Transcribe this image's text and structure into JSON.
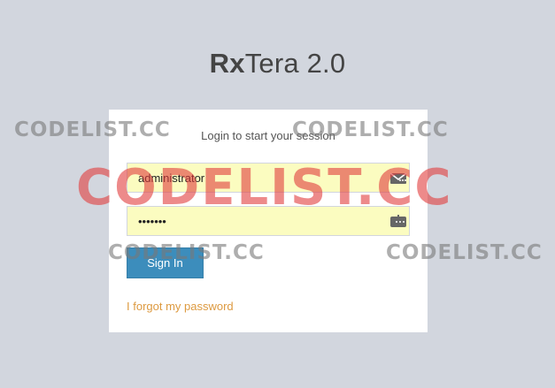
{
  "logo": {
    "bold": "Rx",
    "light": "Tera 2.0"
  },
  "login": {
    "message": "Login to start your session",
    "username_value": "administrator",
    "password_value": "•••••••",
    "signin_label": "Sign In",
    "forgot_label": "I forgot my password"
  },
  "icons": {
    "username": "envelope-icon",
    "password": "keyboard-icon"
  },
  "watermarks": {
    "small1": "CODELIST.CC",
    "small2": "CODELIST.CC",
    "big": "CODELIST.CC",
    "small3": "CODELIST.CC",
    "small4": "CODELIST.CC"
  },
  "colors": {
    "background": "#d2d6de",
    "button": "#3c8dbc",
    "link": "#dd9a40",
    "input_autofill": "#fbfcc0"
  }
}
